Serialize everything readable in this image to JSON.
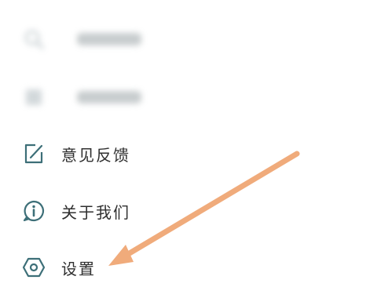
{
  "menu": {
    "items": [
      {
        "label": "",
        "icon": "search-icon",
        "blurred": true
      },
      {
        "label": "",
        "icon": "help-center-icon",
        "blurred": true
      },
      {
        "label": "意见反馈",
        "icon": "feedback-edit-icon",
        "blurred": false
      },
      {
        "label": "关于我们",
        "icon": "info-icon",
        "blurred": false
      },
      {
        "label": "设置",
        "icon": "settings-hexagon-icon",
        "blurred": false
      }
    ]
  },
  "colors": {
    "icon_teal": "#3d6f78",
    "label_text": "#2f2f2f",
    "arrow": "#f0ab7b"
  }
}
